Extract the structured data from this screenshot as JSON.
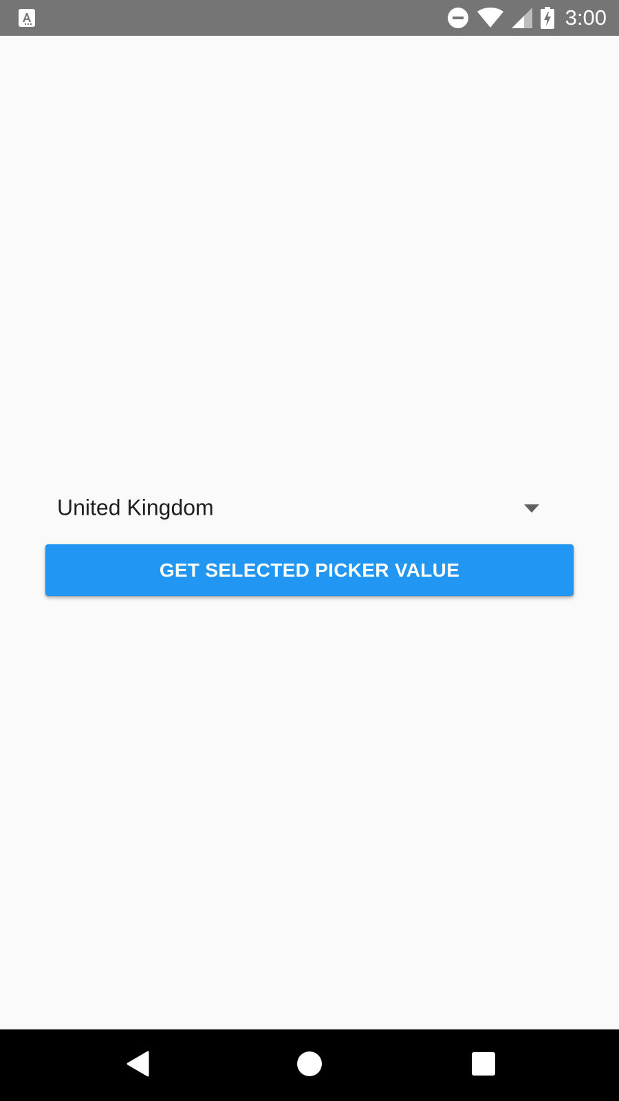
{
  "status_bar": {
    "time": "3:00",
    "icons": [
      "app-notification-icon",
      "do-not-disturb-icon",
      "wifi-icon",
      "cellular-signal-icon",
      "battery-charging-icon"
    ],
    "background": "#757575"
  },
  "picker": {
    "selected_value": "United Kingdom",
    "icon": "dropdown-arrow-icon"
  },
  "button": {
    "label": "GET SELECTED PICKER VALUE",
    "color": "#2196F3"
  },
  "nav_bar": {
    "icons": [
      "back-icon",
      "home-icon",
      "recents-icon"
    ],
    "background": "#000000"
  }
}
